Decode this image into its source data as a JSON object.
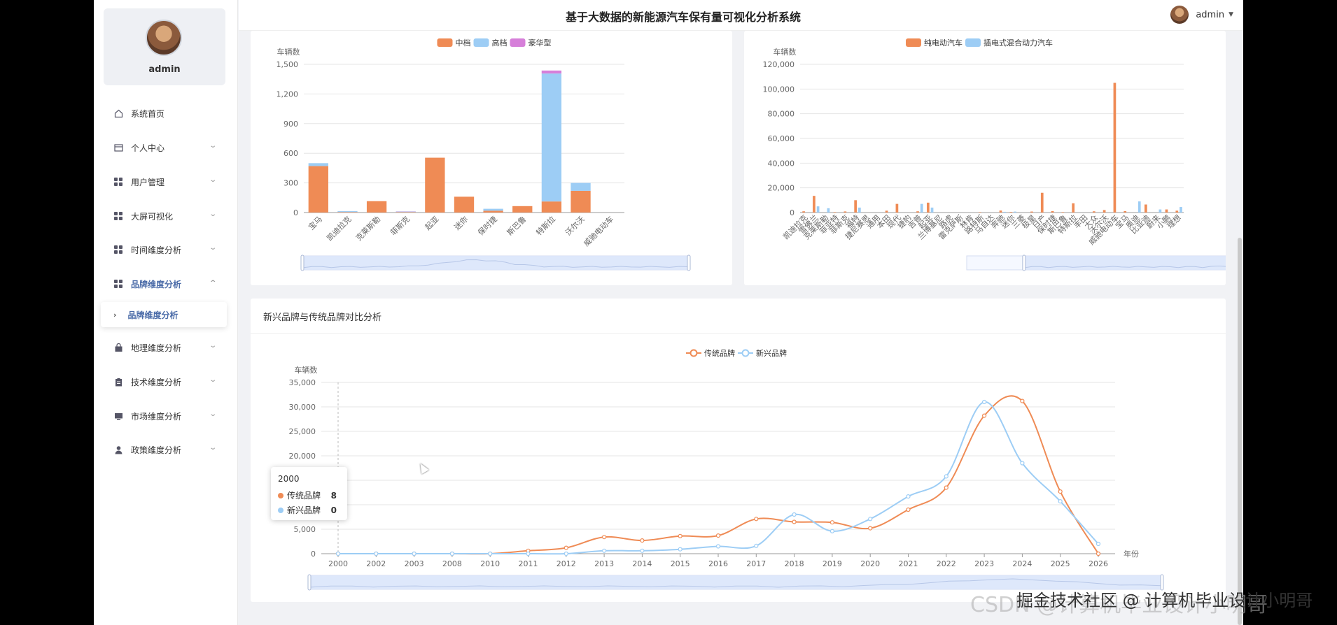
{
  "header": {
    "title": "基于大数据的新能源汽车保有量可视化分析系统",
    "user_name": "admin"
  },
  "sidebar": {
    "user_name": "admin",
    "items": [
      {
        "label": "系统首页",
        "icon": "home-icon"
      },
      {
        "label": "个人中心",
        "icon": "card-icon"
      },
      {
        "label": "用户管理",
        "icon": "grid-icon"
      },
      {
        "label": "大屏可视化",
        "icon": "grid-icon"
      },
      {
        "label": "时间维度分析",
        "icon": "grid-icon"
      },
      {
        "label": "品牌维度分析",
        "icon": "grid-icon"
      },
      {
        "label": "地理维度分析",
        "icon": "bag-icon"
      },
      {
        "label": "技术维度分析",
        "icon": "clipboard-icon"
      },
      {
        "label": "市场维度分析",
        "icon": "monitor-icon"
      },
      {
        "label": "政策维度分析",
        "icon": "person-icon"
      }
    ],
    "submenu_label": "品牌维度分析"
  },
  "colors": {
    "orange": "#ef8b55",
    "blue": "#9dcdf5",
    "purple": "#d67fd9",
    "menu_active": "#4a6ba8"
  },
  "panel3": {
    "title": "新兴品牌与传统品牌对比分析"
  },
  "tooltip": {
    "title": "2000",
    "rows": [
      {
        "name": "传统品牌",
        "value": "8"
      },
      {
        "name": "新兴品牌",
        "value": "0"
      }
    ]
  },
  "watermark": {
    "line1": "CSDN @计算机毕业设计小明哥",
    "line2": "掘金技术社区 @ 计算机毕业设计小明哥"
  },
  "chart_data": [
    {
      "type": "bar",
      "stacked": true,
      "ylabel": "车辆数",
      "ylim": [
        0,
        1500
      ],
      "yticks": [
        "0",
        "300",
        "600",
        "900",
        "1,200",
        "1,500"
      ],
      "categories": [
        "宝马",
        "凯迪拉克",
        "克莱斯勒",
        "菲斯克",
        "起亚",
        "迷你",
        "保时捷",
        "斯巴鲁",
        "特斯拉",
        "沃尔沃",
        "威驰电动车"
      ],
      "series": [
        {
          "name": "中档",
          "values": [
            470,
            5,
            115,
            5,
            555,
            160,
            18,
            65,
            112,
            220,
            0
          ]
        },
        {
          "name": "高档",
          "values": [
            30,
            10,
            0,
            5,
            0,
            0,
            20,
            0,
            1295,
            80,
            0
          ]
        },
        {
          "name": "豪华型",
          "values": [
            0,
            0,
            0,
            2,
            0,
            0,
            0,
            0,
            30,
            0,
            0
          ]
        }
      ],
      "legend": "top-center"
    },
    {
      "type": "bar",
      "ylabel": "车辆数",
      "ylim": [
        0,
        120000
      ],
      "yticks": [
        "0",
        "20,000",
        "40,000",
        "60,000",
        "80,000",
        "100,000",
        "120,000"
      ],
      "categories": [
        "凯迪拉克",
        "雪佛兰",
        "克莱斯勒",
        "菲亚特",
        "菲斯克",
        "福特",
        "捷尼赛思",
        "通用",
        "本田",
        "现代",
        "捷豹",
        "吉普",
        "起亚",
        "兰博基尼",
        "路虎",
        "雷克萨斯",
        "林肯",
        "路特斯",
        "马自达",
        "奔驰",
        "迷你",
        "三菱",
        "极星",
        "日产",
        "保时捷",
        "斯巴鲁",
        "特斯拉",
        "丰田",
        "大众",
        "沃尔沃",
        "威驰电动车",
        "宝马",
        "奥迪",
        "比亚迪",
        "蔚来",
        "小鹏",
        "理想"
      ],
      "series": [
        {
          "name": "纯电动汽车",
          "values": [
            1000,
            13500,
            0,
            400,
            900,
            10000,
            0,
            0,
            1500,
            7000,
            0,
            1000,
            8000,
            0,
            0,
            0,
            0,
            400,
            0,
            1600,
            500,
            0,
            800,
            16000,
            1200,
            400,
            7500,
            0,
            1000,
            2000,
            105000,
            1200,
            0,
            6500,
            0,
            2500,
            1500
          ]
        },
        {
          "name": "插电式混合动力汽车",
          "values": [
            0,
            5000,
            3500,
            0,
            0,
            4000,
            0,
            0,
            0,
            0,
            0,
            7000,
            4000,
            0,
            0,
            0,
            0,
            0,
            0,
            600,
            800,
            0,
            0,
            0,
            0,
            0,
            0,
            0,
            0,
            0,
            0,
            0,
            9000,
            0,
            2500,
            0,
            4500
          ]
        }
      ],
      "legend": "top-center"
    },
    {
      "type": "line",
      "title": "新兴品牌与传统品牌对比分析",
      "xlabel": "年份",
      "ylabel": "车辆数",
      "ylim": [
        0,
        35000
      ],
      "yticks": [
        "0",
        "5,000",
        "10,000",
        "15,000",
        "20,000",
        "25,000",
        "30,000",
        "35,000"
      ],
      "x": [
        "2000",
        "2002",
        "2003",
        "2008",
        "2010",
        "2011",
        "2012",
        "2013",
        "2014",
        "2015",
        "2016",
        "2017",
        "2018",
        "2019",
        "2020",
        "2021",
        "2022",
        "2023",
        "2024",
        "2025",
        "2026"
      ],
      "series": [
        {
          "name": "传统品牌",
          "values": [
            8,
            0,
            0,
            0,
            0,
            600,
            1200,
            3400,
            2700,
            3600,
            3700,
            7100,
            6500,
            6400,
            5200,
            9000,
            13500,
            28200,
            31200,
            12700,
            0
          ]
        },
        {
          "name": "新兴品牌",
          "values": [
            0,
            0,
            0,
            0,
            0,
            0,
            0,
            600,
            600,
            900,
            1500,
            1600,
            8000,
            4600,
            7100,
            11700,
            15800,
            31000,
            18500,
            10700,
            2000
          ]
        }
      ],
      "legend": "top-center"
    }
  ]
}
